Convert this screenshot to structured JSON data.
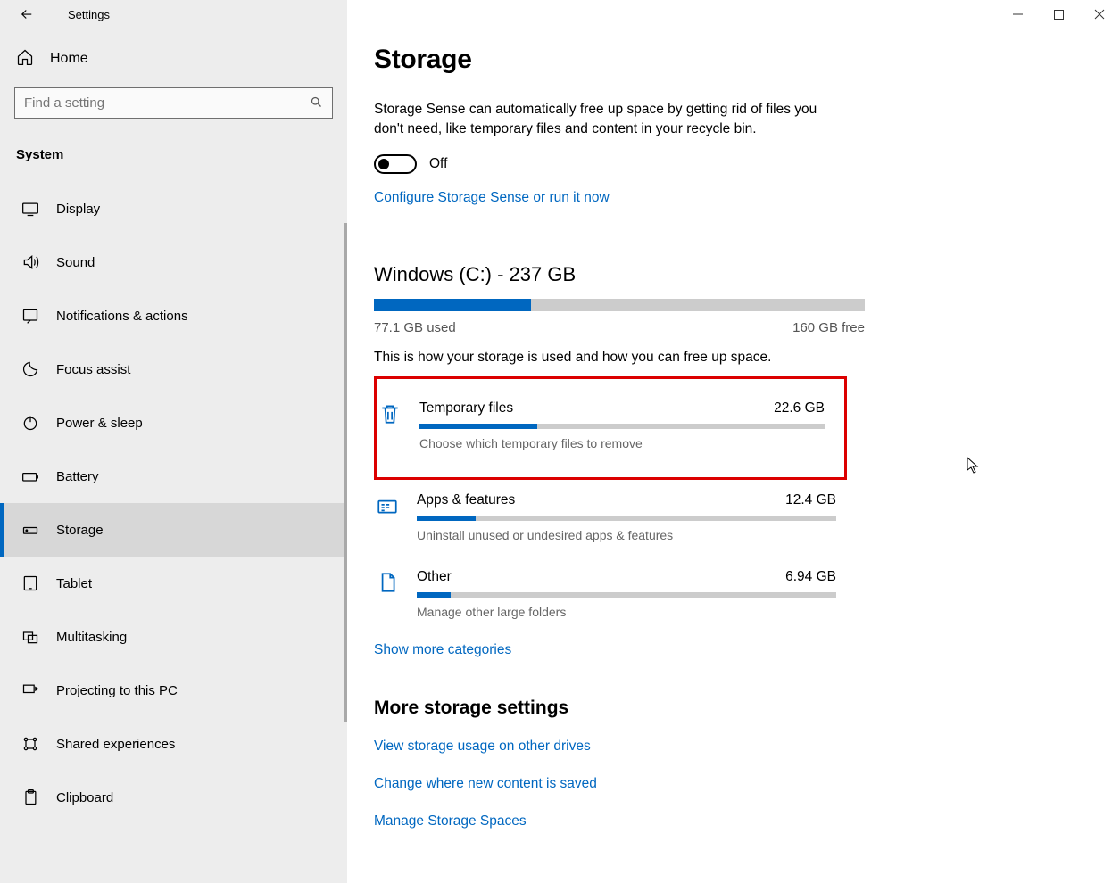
{
  "window": {
    "title": "Settings",
    "home": "Home",
    "searchPlaceholder": "Find a setting",
    "section": "System"
  },
  "nav": [
    {
      "id": "display",
      "label": "Display"
    },
    {
      "id": "sound",
      "label": "Sound"
    },
    {
      "id": "notifications",
      "label": "Notifications & actions"
    },
    {
      "id": "focus-assist",
      "label": "Focus assist"
    },
    {
      "id": "power-sleep",
      "label": "Power & sleep"
    },
    {
      "id": "battery",
      "label": "Battery"
    },
    {
      "id": "storage",
      "label": "Storage",
      "active": true
    },
    {
      "id": "tablet",
      "label": "Tablet"
    },
    {
      "id": "multitasking",
      "label": "Multitasking"
    },
    {
      "id": "projecting",
      "label": "Projecting to this PC"
    },
    {
      "id": "shared-exp",
      "label": "Shared experiences"
    },
    {
      "id": "clipboard",
      "label": "Clipboard"
    }
  ],
  "page": {
    "title": "Storage",
    "description": "Storage Sense can automatically free up space by getting rid of files you don't need, like temporary files and content in your recycle bin.",
    "toggleLabel": "Off",
    "configureLink": "Configure Storage Sense or run it now",
    "disk": {
      "title": "Windows (C:) - 237 GB",
      "used": "77.1 GB used",
      "free": "160 GB free",
      "fillPercent": 32,
      "desc": "This is how your storage is used and how you can free up space."
    },
    "categories": [
      {
        "id": "temp",
        "name": "Temporary files",
        "size": "22.6 GB",
        "desc": "Choose which temporary files to remove",
        "fill": 29,
        "highlight": true
      },
      {
        "id": "apps",
        "name": "Apps & features",
        "size": "12.4 GB",
        "desc": "Uninstall unused or undesired apps & features",
        "fill": 14
      },
      {
        "id": "other",
        "name": "Other",
        "size": "6.94 GB",
        "desc": "Manage other large folders",
        "fill": 8
      }
    ],
    "showMore": "Show more categories",
    "moreHeading": "More storage settings",
    "moreLinks": [
      "View storage usage on other drives",
      "Change where new content is saved",
      "Manage Storage Spaces"
    ]
  }
}
